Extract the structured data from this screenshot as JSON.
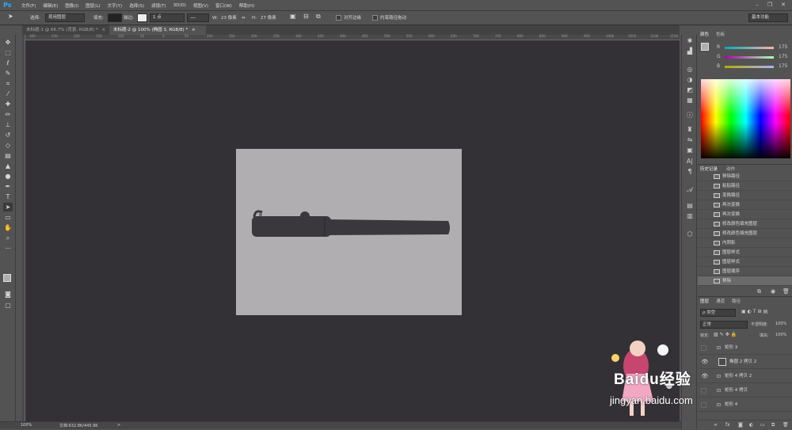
{
  "app": {
    "logo": "Ps"
  },
  "menu": [
    "文件(F)",
    "编辑(E)",
    "图像(I)",
    "图层(L)",
    "文字(Y)",
    "选择(S)",
    "滤镜(T)",
    "3D(D)",
    "视图(V)",
    "窗口(W)",
    "帮助(H)"
  ],
  "window_controls": {
    "minimize": "–",
    "restore": "❐",
    "close": "✕"
  },
  "options": {
    "select_label": "选择:",
    "select_value": "现用图层",
    "fill_label": "填充:",
    "stroke_label": "描边:",
    "stroke_width": "1 点",
    "w_label": "W:",
    "w_value": "23 像素",
    "link": "⇔",
    "h_label": "H:",
    "h_value": "27 像素",
    "align_edges": "对齐边缘",
    "constrain_path": "约束路径拖动",
    "workspace": "基本功能"
  },
  "tabs": [
    {
      "label": "未标题-1 @ 66.7% (背景, RGB/8) *",
      "close": "×"
    },
    {
      "label": "未标题-2 @ 100% (椭圆 3, RGB/8) *",
      "close": "×"
    }
  ],
  "ruler": [
    "300",
    "250",
    "200",
    "150",
    "100",
    "50",
    "0",
    "50",
    "100",
    "150",
    "200",
    "250",
    "300",
    "350",
    "400",
    "450",
    "500",
    "550",
    "600",
    "650",
    "700",
    "750",
    "800",
    "850",
    "900",
    "950",
    "1000",
    "1050",
    "1100",
    "1150"
  ],
  "status": {
    "zoom": "100%",
    "doc": "文档:632.8K/445.9K",
    "arrow": ">"
  },
  "color_panel": {
    "tabs": [
      "颜色",
      "色板"
    ],
    "channels": [
      {
        "label": "R",
        "value": "175"
      },
      {
        "label": "G",
        "value": "175"
      },
      {
        "label": "B",
        "value": "175"
      }
    ]
  },
  "history_panel": {
    "tabs": [
      "历史记录",
      "动作"
    ],
    "items": [
      "移除路径",
      "粘贴路径",
      "变换路径",
      "再次变换",
      "再次变换",
      "修改颜色填充图层",
      "修改颜色填充图层",
      "内阴影",
      "图层样式",
      "图层样式",
      "图层顺序",
      "移除"
    ]
  },
  "layers_panel": {
    "tabs": [
      "图层",
      "通道",
      "路径"
    ],
    "kind_filter": "ρ 类型",
    "blend_mode": "正常",
    "opacity_label": "不透明度:",
    "opacity_value": "100%",
    "lock_label": "锁定:",
    "fill_label": "填充:",
    "fill_value": "100%",
    "layers": [
      {
        "name": "矩形 3",
        "visible": false
      },
      {
        "name": "椭圆 2 拷贝 2",
        "visible": true
      },
      {
        "name": "矩形 4 拷贝 2",
        "visible": true
      },
      {
        "name": "矩形 4 拷贝",
        "visible": false
      },
      {
        "name": "矩形 4",
        "visible": false
      }
    ],
    "footer_icons": [
      "link-icon",
      "fx-icon",
      "mask-icon",
      "adjustment-icon",
      "folder-icon",
      "new-layer-icon",
      "trash-icon"
    ]
  },
  "watermark": {
    "brand_text": "Baidu经验",
    "url": "jingyan.baidu.com"
  },
  "colors": {
    "workspace": "#343136",
    "canvas": "#b1aeb1",
    "shape": "#3b383d",
    "panel": "#535353"
  }
}
